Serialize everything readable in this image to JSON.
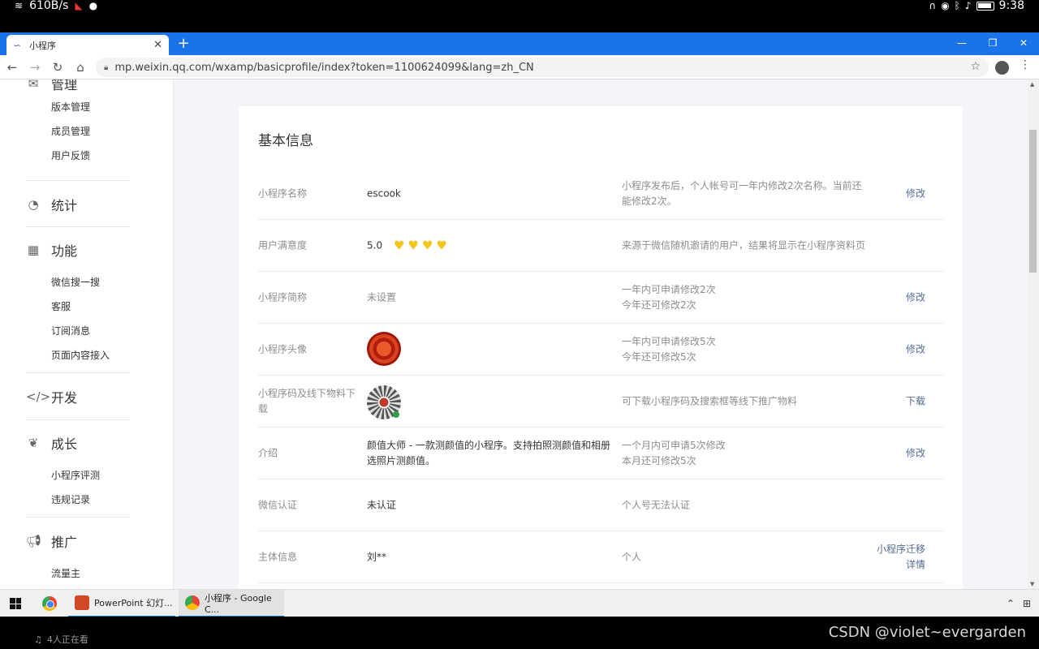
{
  "status_bar": {
    "speed": "610B/s",
    "time": "9:38"
  },
  "browser": {
    "tab_title": "小程序",
    "url": "mp.weixin.qq.com/wxamp/basicprofile/index?token=1100624099&lang=zh_CN"
  },
  "sidebar": {
    "top_partial": "管理",
    "manage_items": [
      "版本管理",
      "成员管理",
      "用户反馈"
    ],
    "stats_label": "统计",
    "func_label": "功能",
    "func_items": [
      "微信搜一搜",
      "客服",
      "订阅消息",
      "页面内容接入"
    ],
    "dev_label": "开发",
    "growth_label": "成长",
    "growth_items": [
      "小程序评测",
      "违规记录"
    ],
    "promo_label": "推广",
    "promo_items": [
      "流量主"
    ]
  },
  "profile": {
    "title": "基本信息",
    "rows": [
      {
        "label": "小程序名称",
        "value": "escook",
        "desc": "小程序发布后，个人帐号可一年内修改2次名称。当前还能修改2次。",
        "action": "修改"
      },
      {
        "label": "用户满意度",
        "value": "5.0",
        "rating": 4,
        "desc": "来源于微信随机邀请的用户，结果将显示在小程序资料页",
        "action": ""
      },
      {
        "label": "小程序简称",
        "value": "未设置",
        "desc1": "一年内可申请修改2次",
        "desc2": "今年还可修改2次",
        "action": "修改"
      },
      {
        "label": "小程序头像",
        "value": "",
        "desc1": "一年内可申请修改5次",
        "desc2": "今年还可修改5次",
        "action": "修改"
      },
      {
        "label": "小程序码及线下物料下载",
        "value": "",
        "desc": "可下载小程序码及搜索框等线下推广物料",
        "action": "下载"
      },
      {
        "label": "介绍",
        "value": "颜值大师 - 一款测颜值的小程序。支持拍照测颜值和相册选照片测颜值。",
        "desc1": "一个月内可申请5次修改",
        "desc2": "本月还可修改5次",
        "action": "修改"
      },
      {
        "label": "微信认证",
        "value": "未认证",
        "desc": "个人号无法认证",
        "action": ""
      },
      {
        "label": "主体信息",
        "value": "刘**",
        "desc": "个人",
        "action1": "小程序迁移",
        "action2": "详情"
      }
    ]
  },
  "taskbar": {
    "ppt_task": "PowerPoint 幻灯...",
    "chrome_task": "小程序 - Google C..."
  },
  "footer": {
    "viewers": "4人正在看",
    "credit": "CSDN @violet~evergarden"
  },
  "colors": {
    "chrome_blue": "#1a73e8",
    "link": "#576b95",
    "heart": "#f5c518"
  }
}
